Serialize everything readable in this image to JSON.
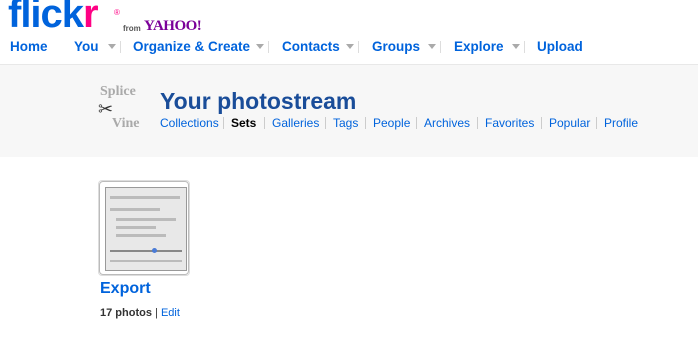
{
  "brand": {
    "logo_main": "flick",
    "logo_r": "r",
    "reg": "®",
    "from": "from",
    "yahoo": "YAHOO!",
    "accent": "#0063dc",
    "pink": "#ff0084"
  },
  "nav": [
    {
      "label": "Home"
    },
    {
      "label": "You",
      "dropdown": true
    },
    {
      "label": "Organize & Create",
      "dropdown": true
    },
    {
      "label": "Contacts",
      "dropdown": true
    },
    {
      "label": "Groups",
      "dropdown": true
    },
    {
      "label": "Explore",
      "dropdown": true
    },
    {
      "label": "Upload"
    }
  ],
  "buddy": {
    "word1": "Splice",
    "word2": "Vine",
    "icon": "scissors-icon"
  },
  "page_title": "Your photostream",
  "subnav": [
    {
      "label": "Collections"
    },
    {
      "label": "Sets",
      "active": true
    },
    {
      "label": "Galleries"
    },
    {
      "label": "Tags"
    },
    {
      "label": "People"
    },
    {
      "label": "Archives"
    },
    {
      "label": "Favorites"
    },
    {
      "label": "Popular"
    },
    {
      "label": "Profile"
    }
  ],
  "set": {
    "title": "Export",
    "count": "17 photos",
    "separator": "|",
    "edit": "Edit"
  }
}
